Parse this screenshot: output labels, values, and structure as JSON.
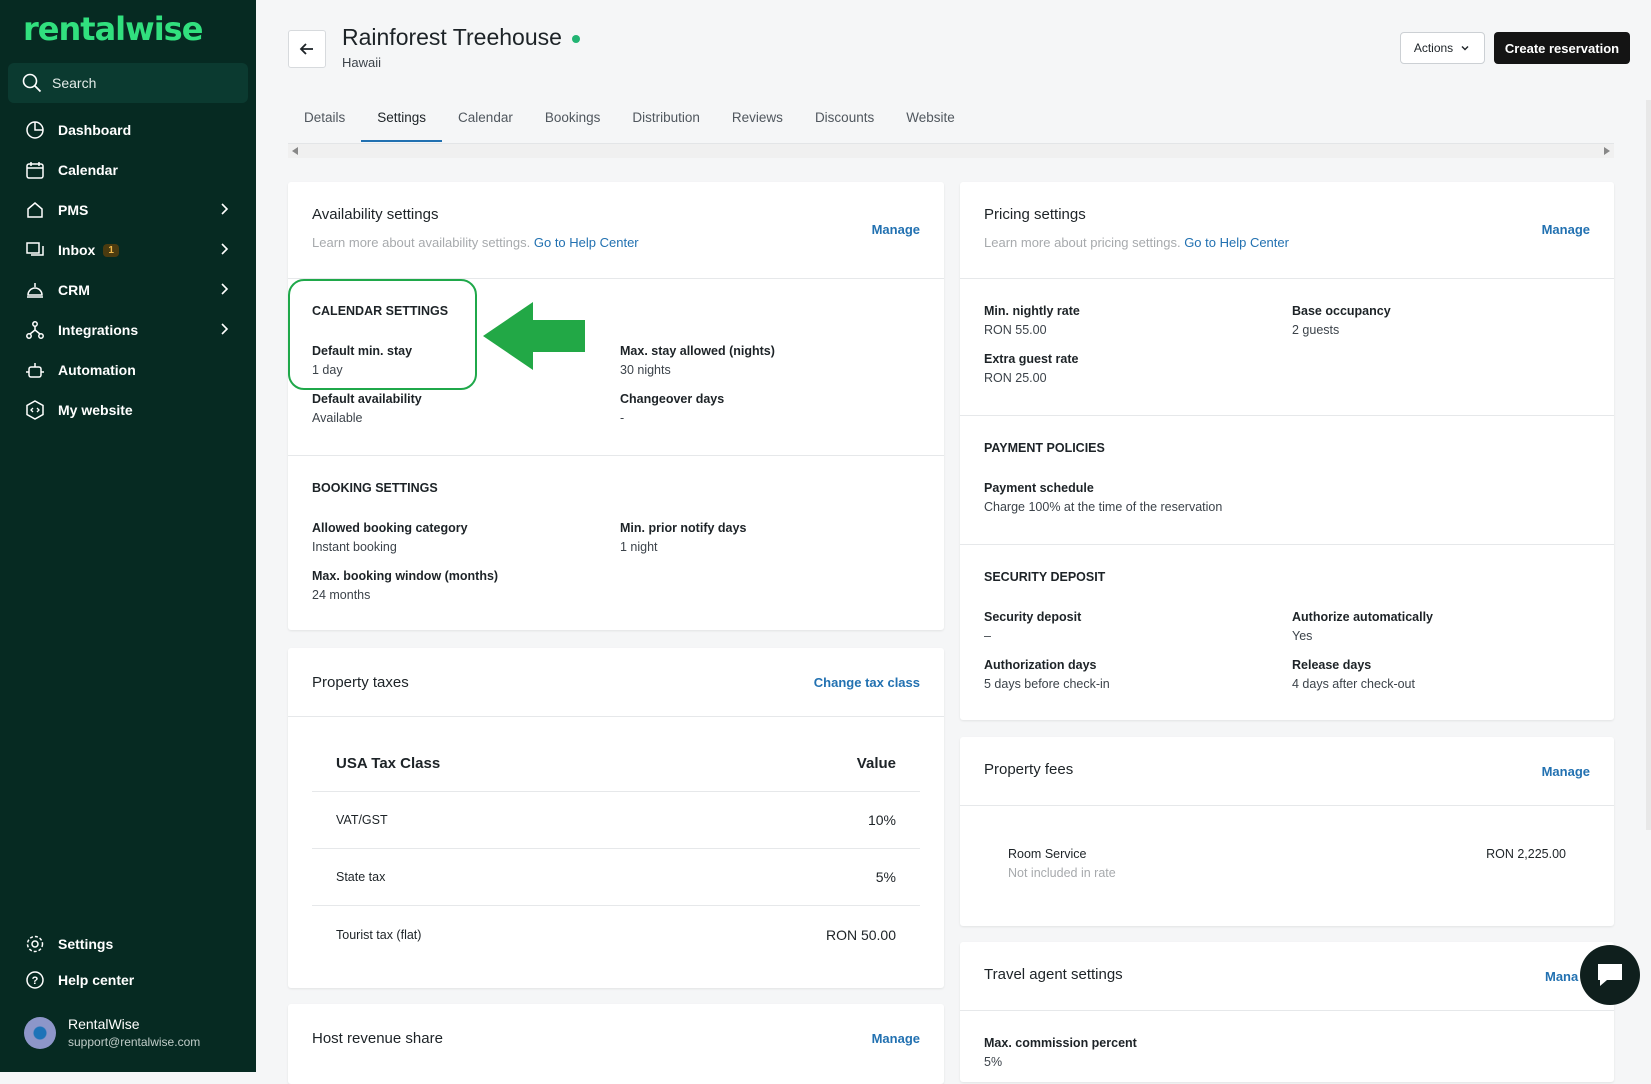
{
  "brand": {
    "logo": "rentalwise"
  },
  "sidebar": {
    "search_label": "Search",
    "items": [
      {
        "label": "Dashboard",
        "icon": "dashboard-icon"
      },
      {
        "label": "Calendar",
        "icon": "calendar-icon"
      },
      {
        "label": "PMS",
        "icon": "pms-icon"
      },
      {
        "label": "Inbox",
        "icon": "inbox-icon",
        "badge": "1"
      },
      {
        "label": "CRM",
        "icon": "crm-icon"
      },
      {
        "label": "Integrations",
        "icon": "integrations-icon"
      },
      {
        "label": "Automation",
        "icon": "automation-icon"
      },
      {
        "label": "My website",
        "icon": "website-icon"
      }
    ],
    "bottom": [
      {
        "label": "Settings",
        "icon": "gear-icon"
      },
      {
        "label": "Help center",
        "icon": "help-icon"
      }
    ],
    "user": {
      "name": "RentalWise",
      "email": "support@rentalwise.com"
    }
  },
  "header": {
    "title": "Rainforest Treehouse",
    "subtitle": "Hawaii",
    "actions_label": "Actions",
    "create_label": "Create reservation"
  },
  "tabs": [
    "Details",
    "Settings",
    "Calendar",
    "Bookings",
    "Distribution",
    "Reviews",
    "Discounts",
    "Website"
  ],
  "availability": {
    "title": "Availability settings",
    "sub_text": "Learn more about availability settings.",
    "sub_link": "Go to Help Center",
    "manage": "Manage",
    "calendar_heading": "CALENDAR SETTINGS",
    "default_min_stay_k": "Default min. stay",
    "default_min_stay_v": "1 day",
    "max_stay_k": "Max. stay allowed (nights)",
    "max_stay_v": "30 nights",
    "default_avail_k": "Default availability",
    "default_avail_v": "Available",
    "changeover_k": "Changeover days",
    "changeover_v": "-",
    "booking_heading": "BOOKING SETTINGS",
    "booking_cat_k": "Allowed booking category",
    "booking_cat_v": "Instant booking",
    "prior_k": "Min. prior notify days",
    "prior_v": "1 night",
    "window_k": "Max. booking window (months)",
    "window_v": "24 months"
  },
  "taxes": {
    "title": "Property taxes",
    "change": "Change tax class",
    "col1": "USA Tax Class",
    "col2": "Value",
    "rows": [
      {
        "name": "VAT/GST",
        "value": "10%"
      },
      {
        "name": "State tax",
        "value": "5%"
      },
      {
        "name": "Tourist tax (flat)",
        "value": "RON 50.00"
      }
    ]
  },
  "host_revenue": {
    "title": "Host revenue share",
    "manage": "Manage"
  },
  "pricing": {
    "title": "Pricing settings",
    "sub_text": "Learn more about pricing settings.",
    "sub_link": "Go to Help Center",
    "manage": "Manage",
    "min_rate_k": "Min. nightly rate",
    "min_rate_v": "RON 55.00",
    "base_occ_k": "Base occupancy",
    "base_occ_v": "2 guests",
    "extra_k": "Extra guest rate",
    "extra_v": "RON 25.00",
    "payment_heading": "PAYMENT POLICIES",
    "schedule_k": "Payment schedule",
    "schedule_v": "Charge 100% at the time of the reservation",
    "deposit_heading": "SECURITY DEPOSIT",
    "deposit_k": "Security deposit",
    "deposit_v": "–",
    "auto_k": "Authorize automatically",
    "auto_v": "Yes",
    "auth_days_k": "Authorization days",
    "auth_days_v": "5 days before check-in",
    "release_k": "Release days",
    "release_v": "4 days after check-out"
  },
  "fees": {
    "title": "Property fees",
    "manage": "Manage",
    "item_name": "Room Service",
    "item_note": "Not included in rate",
    "item_amount": "RON 2,225.00"
  },
  "travel_agent": {
    "title": "Travel agent settings",
    "manage": "Mana",
    "commission_k": "Max. commission percent",
    "commission_v": "5%"
  },
  "colors": {
    "accent": "#2271b1",
    "sidebar": "#062a22",
    "logo": "#31e07e",
    "highlight": "#1fa84a"
  }
}
